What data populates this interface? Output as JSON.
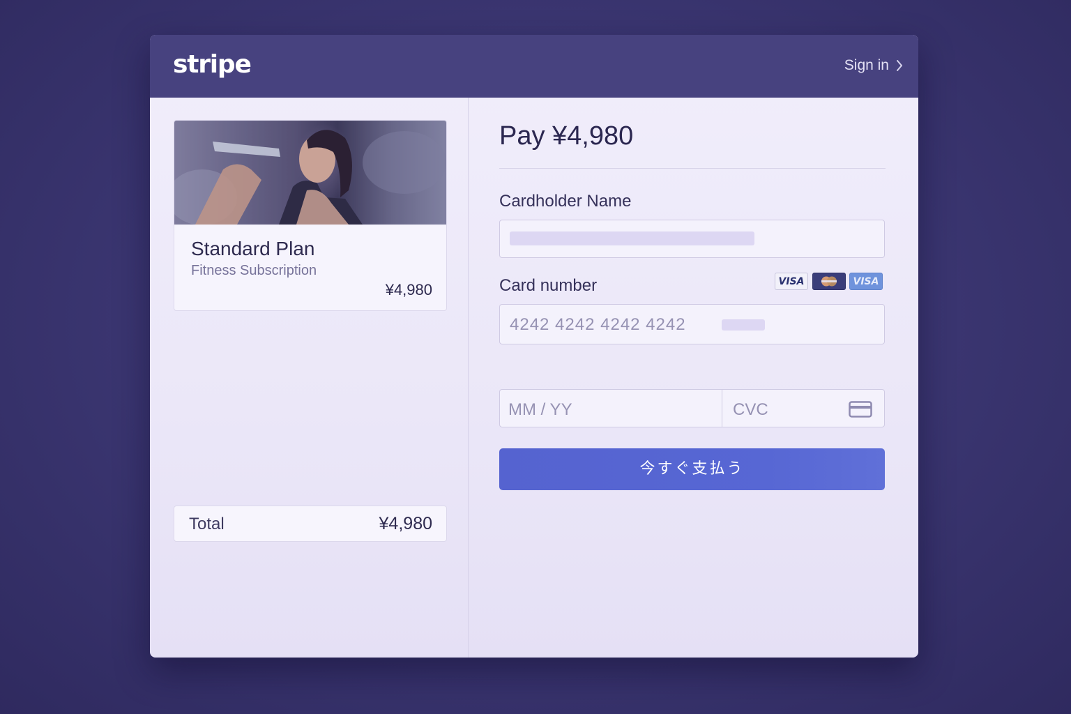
{
  "header": {
    "logo_text": "stripe",
    "signin_label": "Sign in"
  },
  "product": {
    "title": "Standard Plan",
    "subtitle": "Fitness Subscription",
    "price": "¥4,980"
  },
  "summary": {
    "total_label": "Total",
    "total_value": "¥4,980"
  },
  "payment": {
    "title": "Pay ¥4,980",
    "cardholder_label": "Cardholder Name",
    "cardholder_value": "",
    "card_number_label": "Card number",
    "card_number_value": "4242 4242 4242 4242",
    "expiry_placeholder": "MM / YY",
    "cvc_placeholder": "CVC",
    "card_brands": [
      {
        "name": "VISA",
        "icon": "visa-icon"
      },
      {
        "name": "Mastercard",
        "icon": "mastercard-icon"
      },
      {
        "name": "VISA",
        "icon": "visa-icon"
      }
    ],
    "submit_label": "今すぐ支払う"
  },
  "colors": {
    "background": "#3a3570",
    "header": "#47427f",
    "panel": "#efecfa",
    "button": "#5563d0",
    "text_dark": "#2e2a4f"
  }
}
